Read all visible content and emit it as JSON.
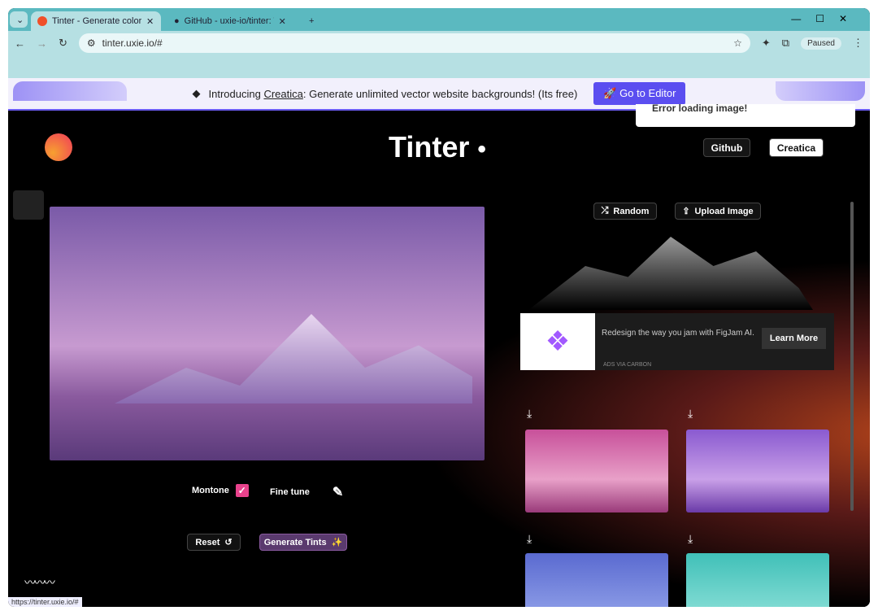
{
  "browser": {
    "tabs": [
      {
        "title": "Tinter - Generate color image"
      },
      {
        "title": "GitHub - uxie-io/tinter: Tinter"
      }
    ],
    "url": "tinter.uxie.io/#",
    "profile": "Paused",
    "status_url": "https://tinter.uxie.io/#"
  },
  "banner": {
    "prefix": "Introducing ",
    "link": "Creatica",
    "suffix": ": Generate unlimited vector website backgrounds! (Its free)",
    "button": "Go to Editor"
  },
  "toast": "Error loading image!",
  "header": {
    "logo": "Tinter",
    "github": "Github",
    "creatica": "Creatica"
  },
  "actions": {
    "random": "Random",
    "upload": "Upload Image"
  },
  "ad": {
    "text": "Redesign the way you jam with FigJam AI.",
    "cta": "Learn More",
    "footer": "ADS VIA CARBON"
  },
  "controls": {
    "monotone": "Montone",
    "monotone_checked": true,
    "fine_tune": "Fine tune",
    "reset": "Reset",
    "generate": "Generate Tints"
  },
  "colors": {
    "accent": "#5b4ef0",
    "check": "#e8428c",
    "generate": "#5a3a6e"
  }
}
